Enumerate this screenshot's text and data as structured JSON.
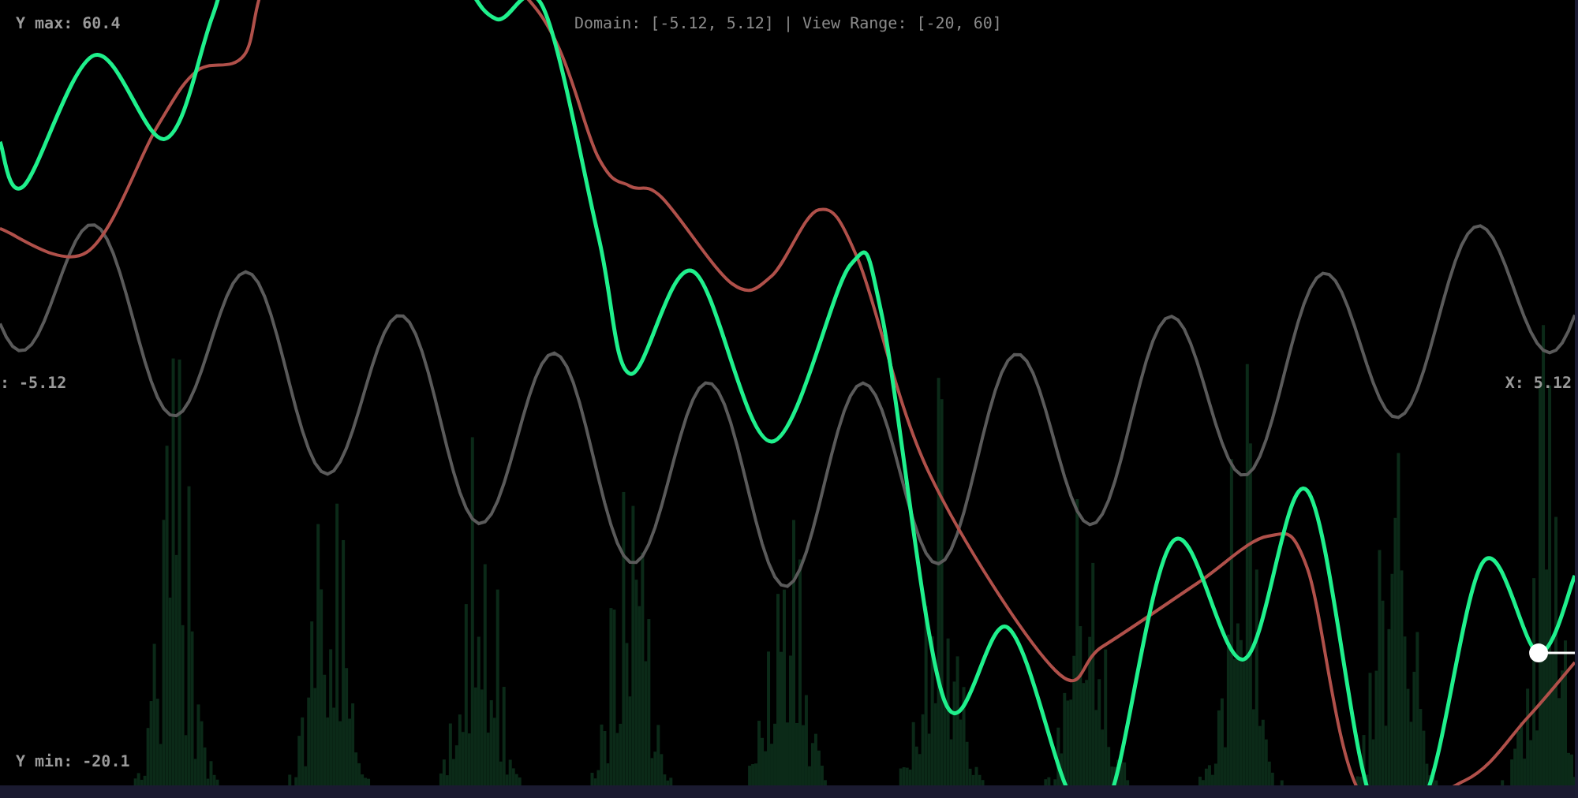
{
  "labels": {
    "y_max": "Y max: 60.4",
    "domain": "Domain: [-5.12, 5.12] | View Range: [-20, 60]",
    "x_min": ": -5.12",
    "x_max": "X: 5.12",
    "y_min": "Y min: -20.1"
  }
}
